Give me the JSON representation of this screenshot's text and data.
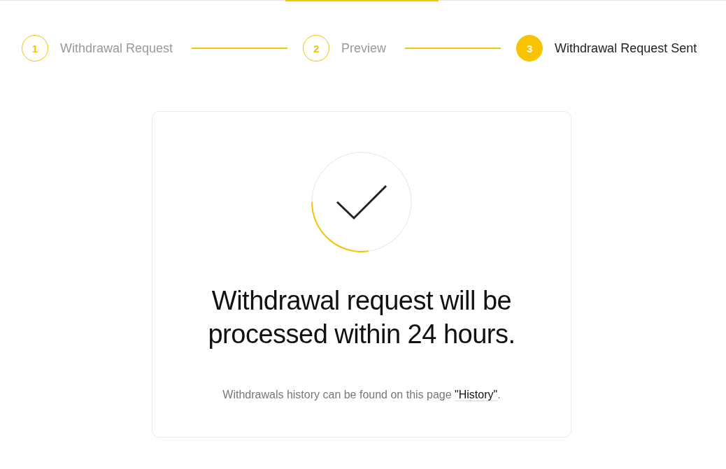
{
  "steps": [
    {
      "number": "1",
      "label": "Withdrawal Request",
      "selected": false
    },
    {
      "number": "2",
      "label": "Preview",
      "selected": false
    },
    {
      "number": "3",
      "label": "Withdrawal Request Sent",
      "selected": true
    }
  ],
  "result": {
    "heading": "Withdrawal request will be processed within 24 hours.",
    "note": {
      "text": "Withdrawals history can be found on this page ",
      "link": "\"History\"",
      "suffix": "."
    }
  }
}
